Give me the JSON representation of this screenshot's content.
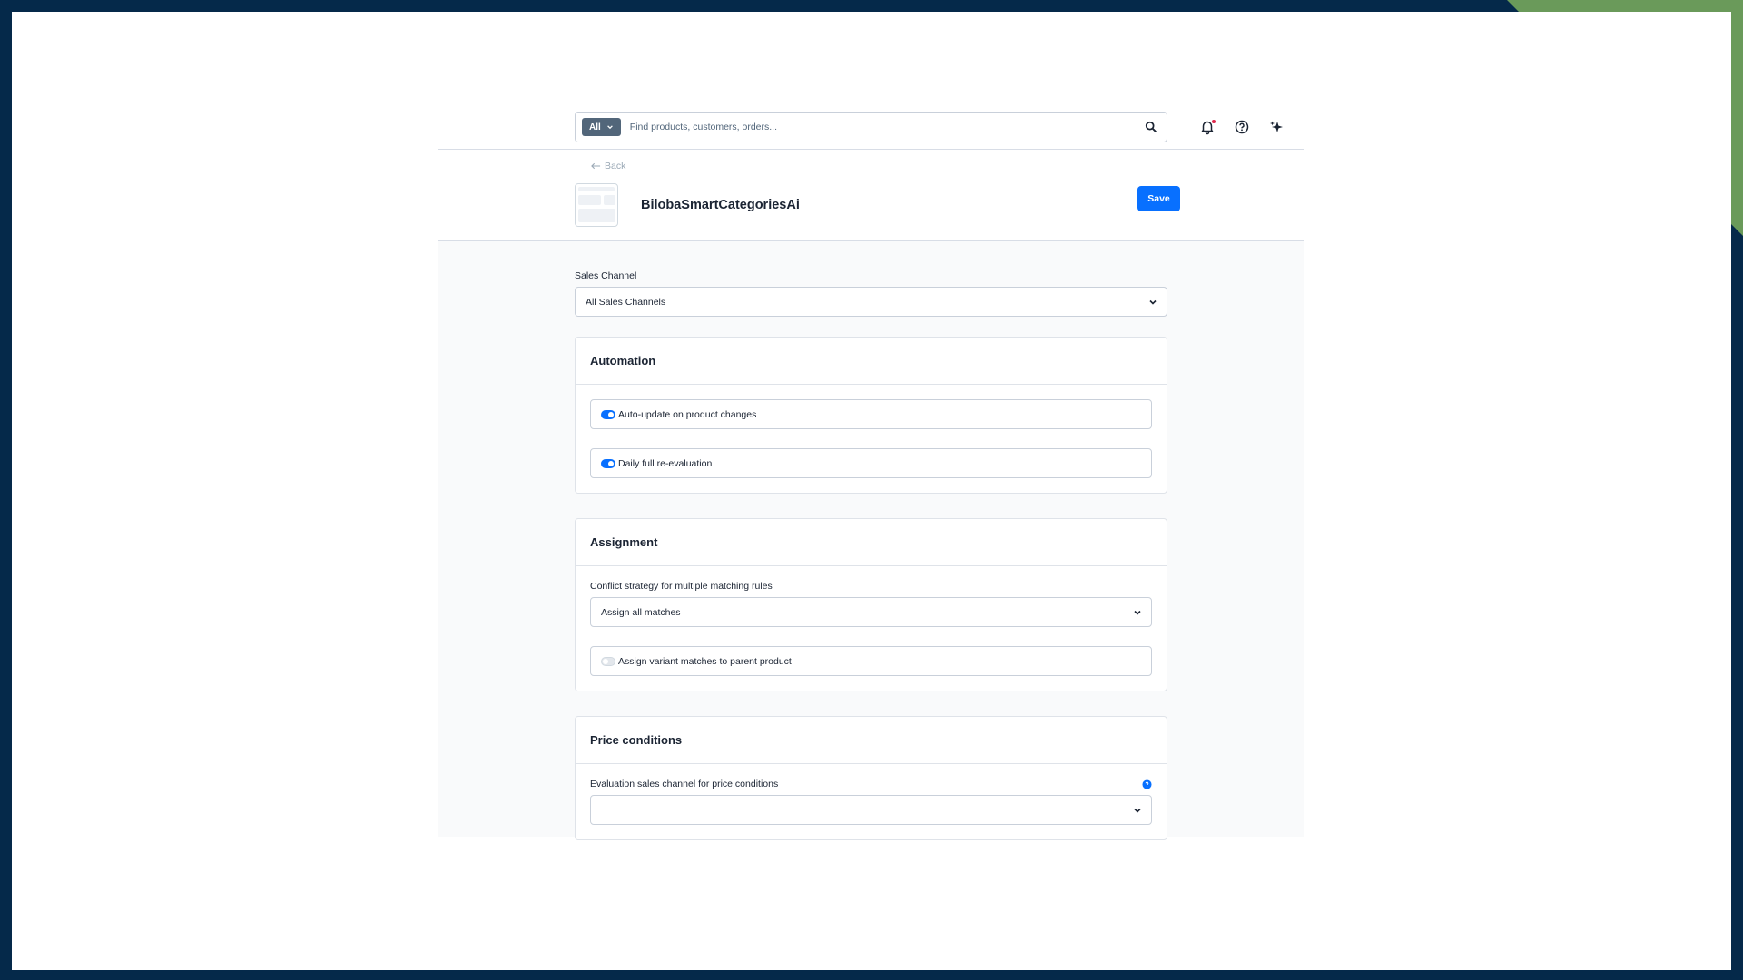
{
  "search": {
    "scope_label": "All",
    "placeholder": "Find products, customers, orders..."
  },
  "header": {
    "back_label": "Back",
    "title": "BilobaSmartCategoriesAi",
    "save_label": "Save"
  },
  "sales_channel": {
    "label": "Sales Channel",
    "value": "All Sales Channels"
  },
  "automation": {
    "title": "Automation",
    "toggles": [
      {
        "label": "Auto-update on product changes",
        "enabled": true
      },
      {
        "label": "Daily full re-evaluation",
        "enabled": true
      }
    ]
  },
  "assignment": {
    "title": "Assignment",
    "conflict_label": "Conflict strategy for multiple matching rules",
    "conflict_value": "Assign all matches",
    "variant_toggle_label": "Assign variant matches to parent product",
    "variant_toggle_enabled": false
  },
  "price_conditions": {
    "title": "Price conditions",
    "eval_label": "Evaluation sales channel for price conditions",
    "eval_value": ""
  },
  "colors": {
    "primary": "#0870ff",
    "scope_button": "#52667a",
    "notification_dot": "#de294c",
    "outer_background": "#05294a",
    "corner_accent": "#6a9a5a"
  }
}
